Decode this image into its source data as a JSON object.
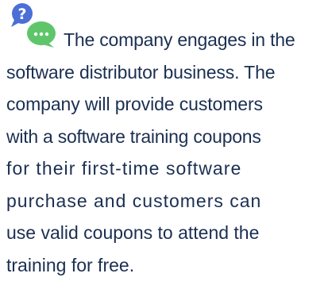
{
  "icon": "question-and-chat-bubble-icon",
  "colors": {
    "text": "#1b2f52",
    "question_bubble": "#4b6fd6",
    "chat_bubble": "#5fc56b"
  },
  "paragraph": {
    "lines": [
      "The company engages in the",
      "software distributor business. The",
      "company will provide customers",
      "with a software training coupons",
      "for their first-time software",
      "purchase and customers can",
      "use valid coupons to attend the",
      "training for free."
    ]
  }
}
